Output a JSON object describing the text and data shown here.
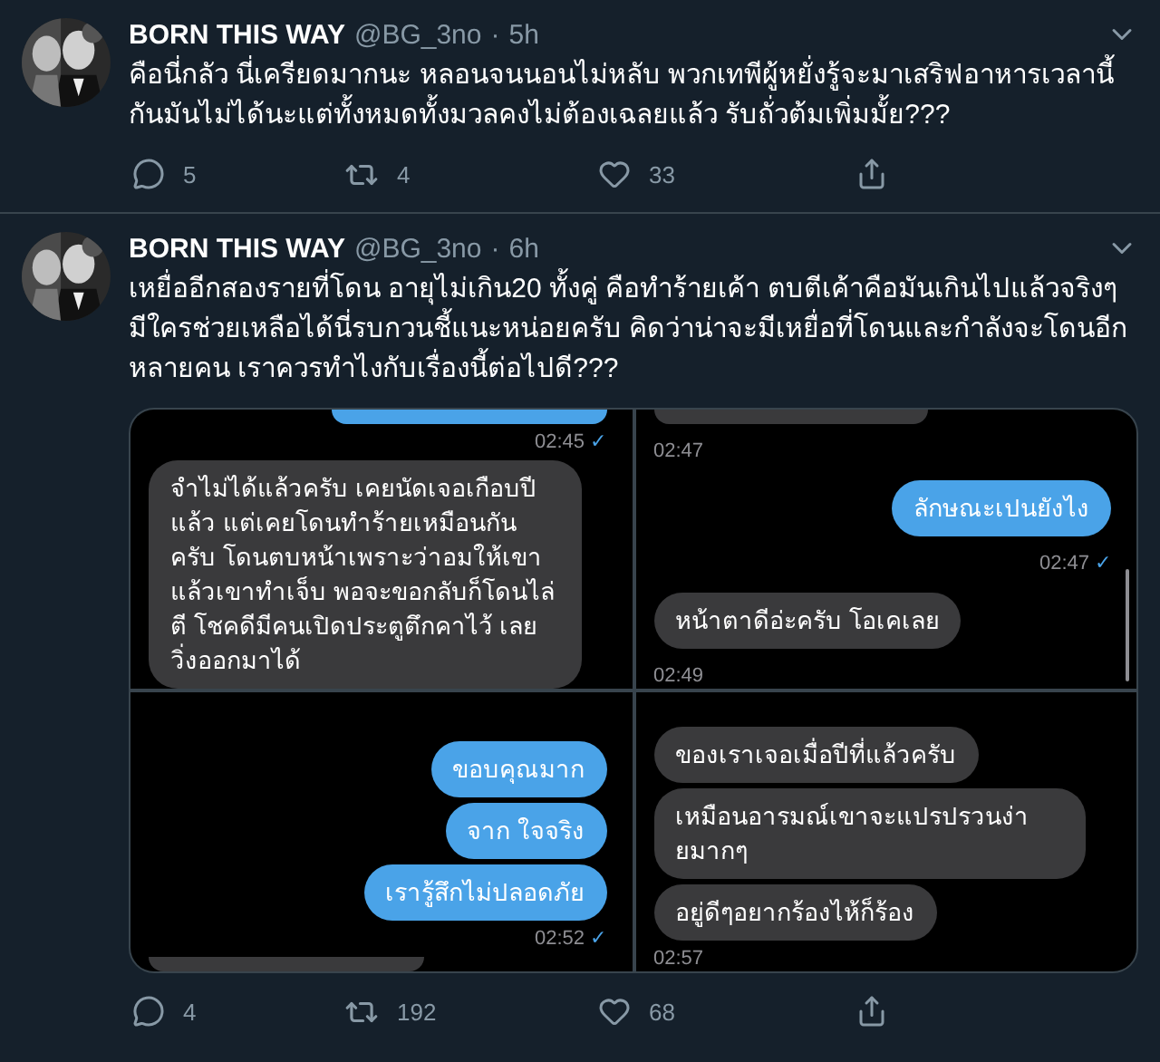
{
  "tweets": [
    {
      "avatar": {
        "kind": "picture"
      },
      "name": "BORN THIS WAY",
      "handle": "@BG_3no",
      "separator": "·",
      "time": "5h",
      "text": "คือนี่กลัว นี่เครียดมากนะ หลอนจนนอนไม่หลับ พวกเทพีผู้หยั่งรู้จะมาเสริฟอาหารเวลานี้กันมันไม่ได้นะแต่ทั้งหมดทั้งมวลคงไม่ต้องเฉลยแล้ว รับถั่วต้มเพิ่มมั้ย???",
      "replies": "5",
      "retweets": "4",
      "likes": "33"
    },
    {
      "avatar": {
        "kind": "picture"
      },
      "name": "BORN THIS WAY",
      "handle": "@BG_3no",
      "separator": "·",
      "time": "6h",
      "text": "เหยื่ออีกสองรายที่โดน อายุไม่เกิน20 ทั้งคู่ คือทำร้ายเค้า ตบตีเค้าคือมันเกินไปแล้วจริงๆ มีใครช่วยเหลือได้นี่รบกวนชี้แนะหน่อยครับ คิดว่าน่าจะมีเหยื่อที่โดนและกำลังจะโดนอีกหลายคน เราควรทำไงกับเรื่องนี้ต่อไปดี???",
      "replies": "4",
      "retweets": "192",
      "likes": "68",
      "media": [
        {
          "scrollbar": false,
          "messages": [
            {
              "kind": "stub",
              "outgoing": true
            },
            {
              "kind": "time",
              "text": "02:45",
              "tick": "✓"
            },
            {
              "kind": "bubble",
              "outgoing": false,
              "text": "จำไม่ได้แล้วครับ เคยนัดเจอเกือบปีแล้ว แต่เคยโดนทำร้ายเหมือนกันครับ โดนตบหน้าเพราะว่าอมให้เขาแล้วเขาทำเจ็บ พอจะขอกลับก็โดนไล่ตี โชคดีมีคนเปิดประตูตึกคาไว้ เลยวิ่งออกมาได้"
            }
          ]
        },
        {
          "scrollbar": true,
          "messages": [
            {
              "kind": "stub",
              "outgoing": false
            },
            {
              "kind": "time",
              "text": "02:47"
            },
            {
              "kind": "bubble",
              "outgoing": true,
              "text": "ลักษณะเปนยังไง"
            },
            {
              "kind": "time",
              "text": "02:47",
              "tick": "✓"
            },
            {
              "kind": "bubble",
              "outgoing": false,
              "text": "หน้าตาดีอ่ะครับ โอเคเลย"
            },
            {
              "kind": "time",
              "text": "02:49"
            }
          ]
        },
        {
          "scrollbar": false,
          "messages": [
            {
              "kind": "bubble",
              "outgoing": true,
              "text": "ขอบคุณมาก"
            },
            {
              "kind": "bubble",
              "outgoing": true,
              "text": "จาก ใจจริง"
            },
            {
              "kind": "bubble",
              "outgoing": true,
              "text": "เรารู้สึกไม่ปลอดภัย"
            },
            {
              "kind": "time",
              "text": "02:52",
              "tick": "✓"
            },
            {
              "kind": "stub",
              "outgoing": false
            }
          ]
        },
        {
          "scrollbar": false,
          "messages": [
            {
              "kind": "bubble",
              "outgoing": false,
              "text": "ของเราเจอเมื่อปีที่แล้วครับ"
            },
            {
              "kind": "bubble",
              "outgoing": false,
              "text": "เหมือนอารมณ์เขาจะแปรปรวนง่ายมากๆ"
            },
            {
              "kind": "bubble",
              "outgoing": false,
              "text": "อยู่ดีๆอยากร้องไห้ก็ร้อง"
            },
            {
              "kind": "time",
              "text": "02:57"
            }
          ]
        }
      ]
    }
  ]
}
